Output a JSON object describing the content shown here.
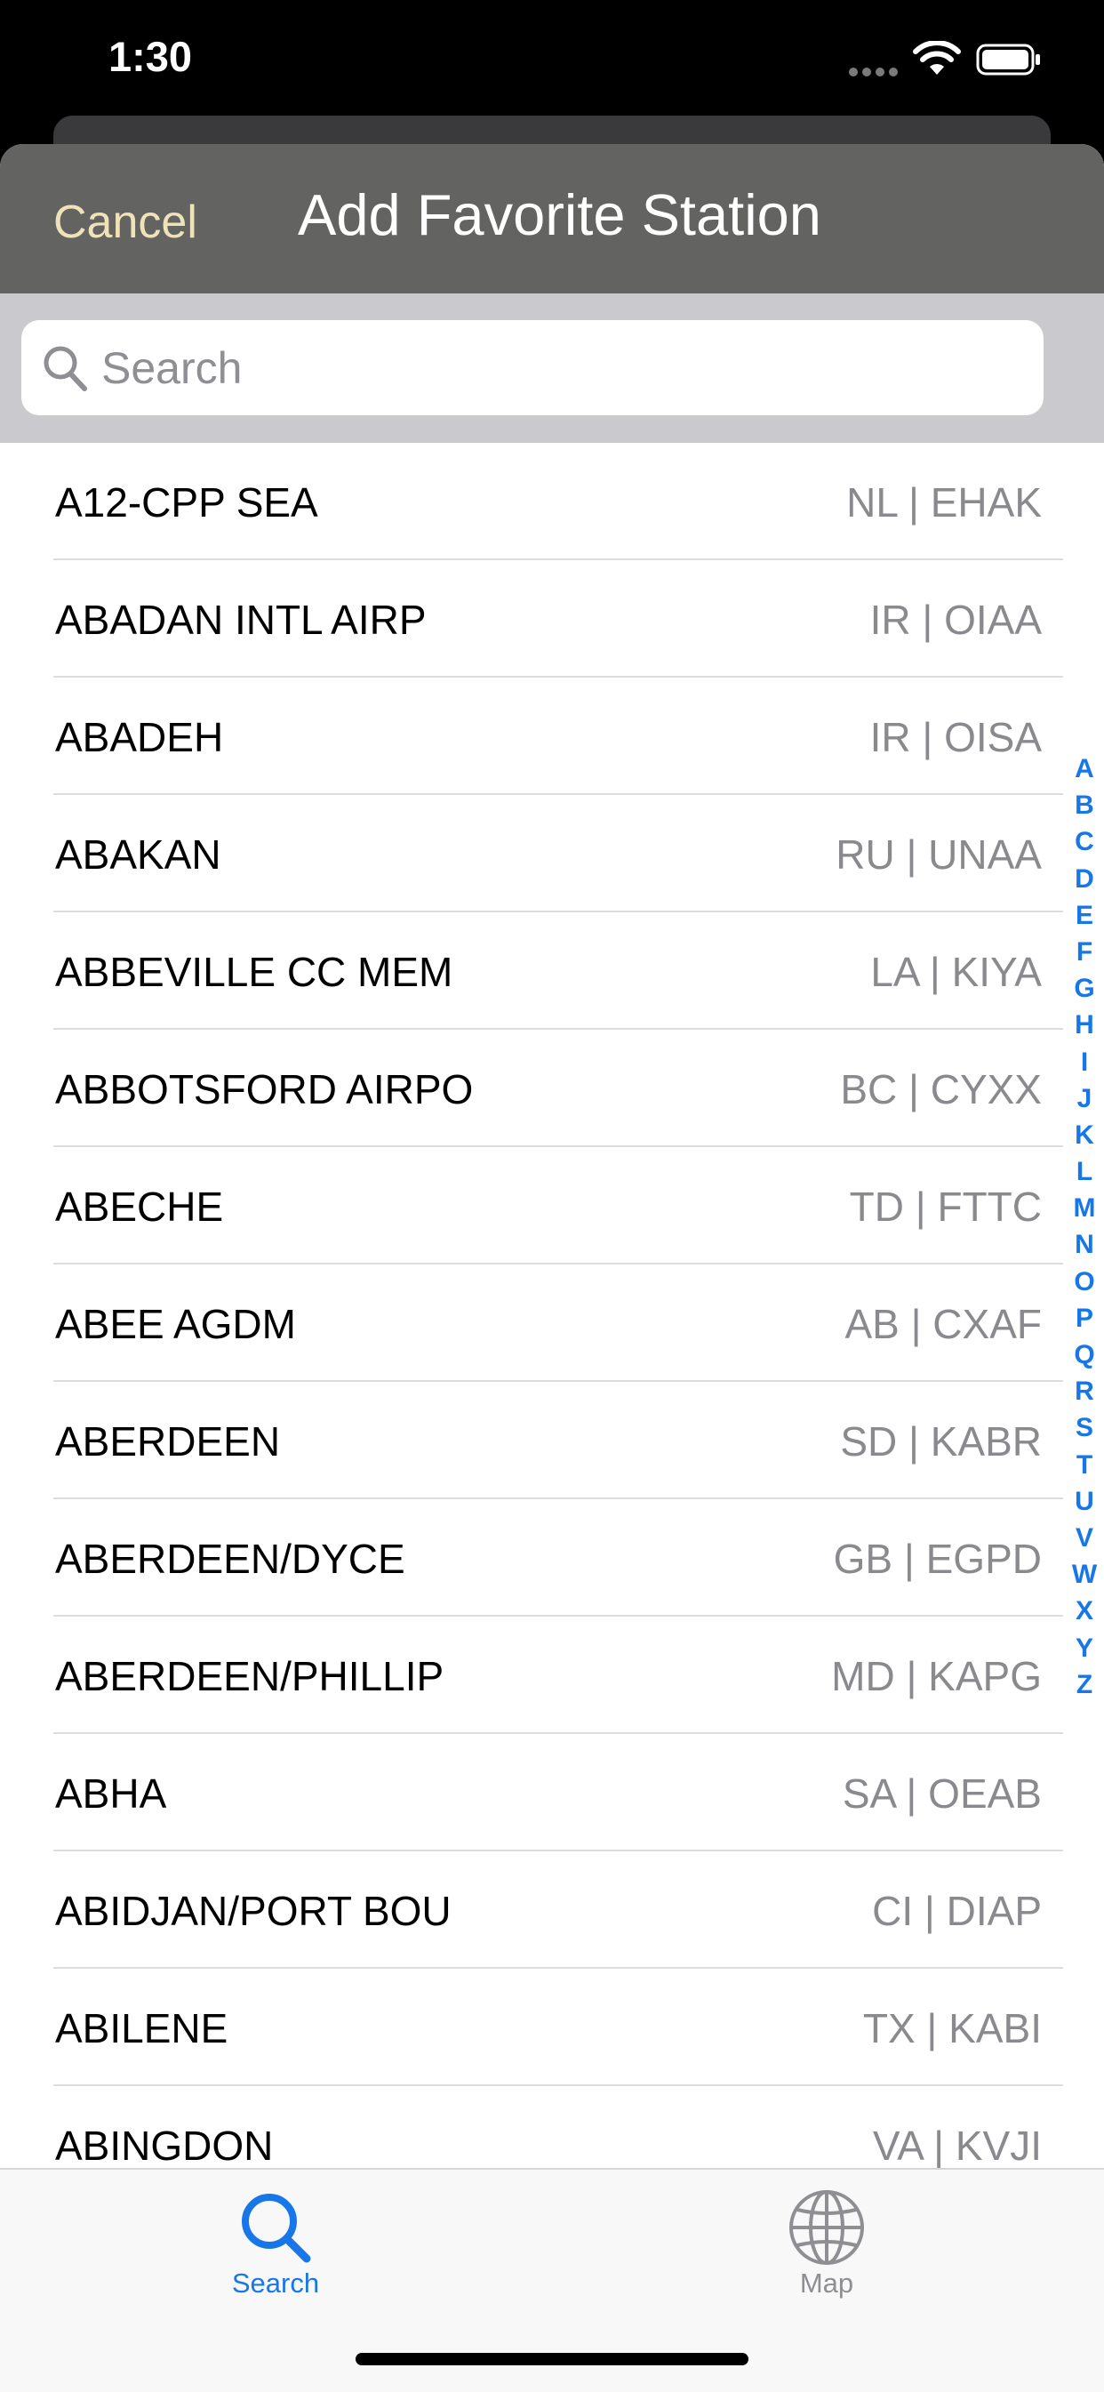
{
  "status_bar": {
    "time": "1:30"
  },
  "nav": {
    "cancel_label": "Cancel",
    "title": "Add Favorite Station"
  },
  "search": {
    "placeholder": "Search",
    "value": ""
  },
  "stations": [
    {
      "name": "A12-CPP SEA",
      "code": "NL | EHAK"
    },
    {
      "name": "ABADAN INTL AIRP",
      "code": "IR | OIAA"
    },
    {
      "name": "ABADEH",
      "code": "IR | OISA"
    },
    {
      "name": "ABAKAN",
      "code": "RU | UNAA"
    },
    {
      "name": "ABBEVILLE CC MEM",
      "code": "LA | KIYA"
    },
    {
      "name": "ABBOTSFORD AIRPO",
      "code": "BC | CYXX"
    },
    {
      "name": "ABECHE",
      "code": "TD | FTTC"
    },
    {
      "name": "ABEE AGDM",
      "code": "AB | CXAF"
    },
    {
      "name": "ABERDEEN",
      "code": "SD | KABR"
    },
    {
      "name": "ABERDEEN/DYCE",
      "code": "GB | EGPD"
    },
    {
      "name": "ABERDEEN/PHILLIP",
      "code": "MD | KAPG"
    },
    {
      "name": "ABHA",
      "code": "SA | OEAB"
    },
    {
      "name": "ABIDJAN/PORT BOU",
      "code": "CI | DIAP"
    },
    {
      "name": "ABILENE",
      "code": "TX | KABI"
    },
    {
      "name": "ABINGDON",
      "code": "VA | KVJI"
    }
  ],
  "section_index": [
    "A",
    "B",
    "C",
    "D",
    "E",
    "F",
    "G",
    "H",
    "I",
    "J",
    "K",
    "L",
    "M",
    "N",
    "O",
    "P",
    "Q",
    "R",
    "S",
    "T",
    "U",
    "V",
    "W",
    "X",
    "Y",
    "Z"
  ],
  "tabs": [
    {
      "label": "Search",
      "icon": "search-icon",
      "selected": true
    },
    {
      "label": "Map",
      "icon": "globe-icon",
      "selected": false
    }
  ],
  "colors": {
    "nav_bar": "#636361",
    "cancel_text": "#efe2b8",
    "accent": "#1877e8",
    "secondary_text": "#8a8a8e"
  }
}
